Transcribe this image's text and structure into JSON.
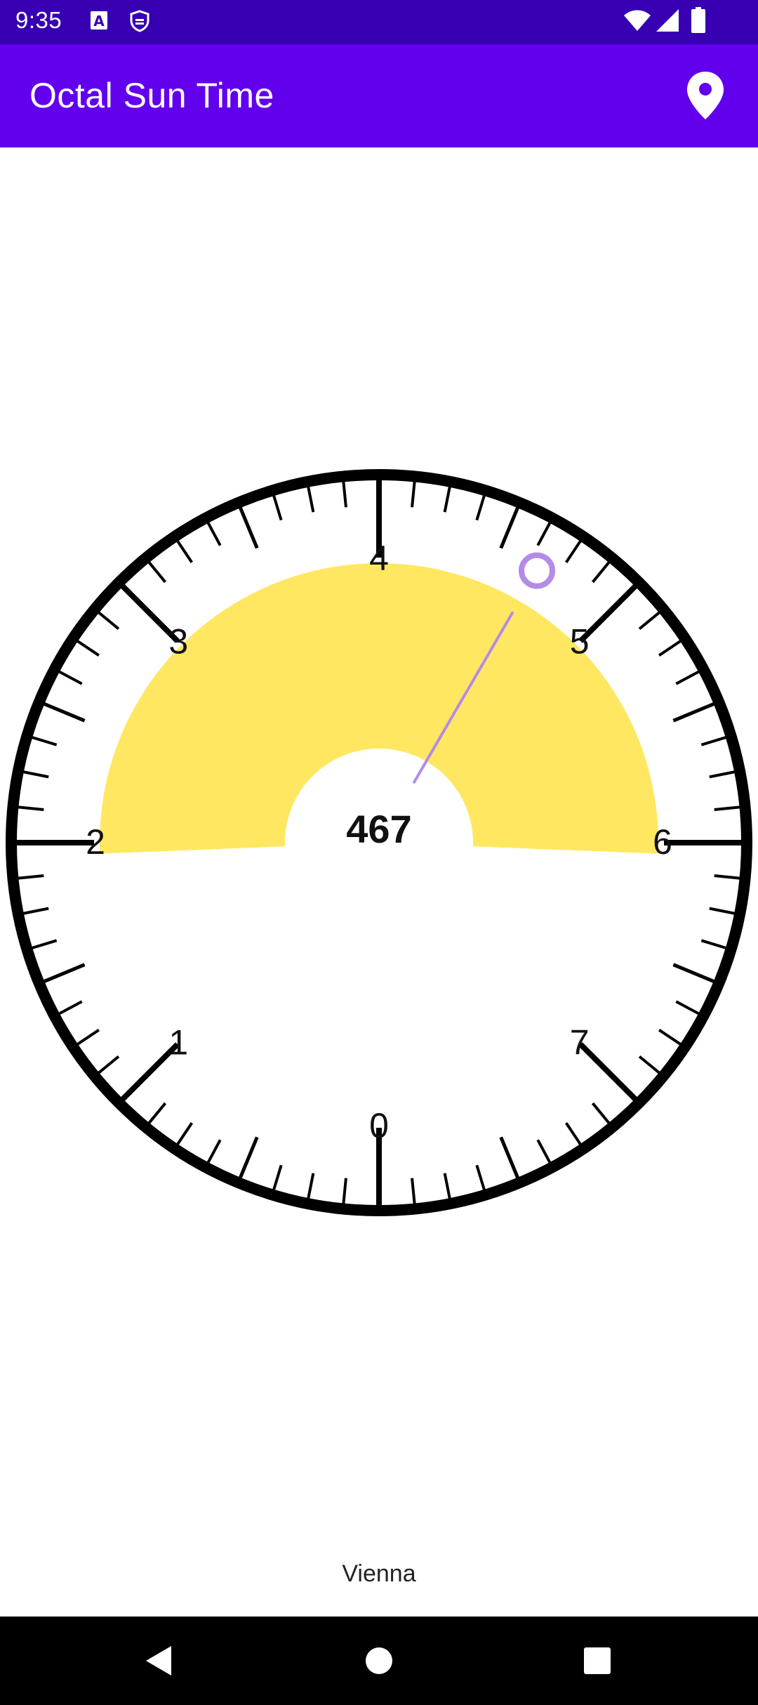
{
  "status_bar": {
    "time": "9:35",
    "icons": [
      "font-a-icon",
      "shield-key-icon",
      "wifi-icon",
      "signal-icon",
      "battery-icon"
    ]
  },
  "app_bar": {
    "title": "Octal Sun Time",
    "action_icon": "location-pin-icon"
  },
  "dial": {
    "center_value": "467",
    "hour_labels": [
      "0",
      "1",
      "2",
      "3",
      "4",
      "5",
      "6",
      "7"
    ],
    "hand_octal_hours": 4.67,
    "daylight_start_octal_hours": 1.95,
    "daylight_end_octal_hours": 6.05,
    "colors": {
      "ring": "#000000",
      "daylight": "#ffe761",
      "hand": "#b48be6"
    }
  },
  "location": {
    "city": "Vienna"
  },
  "nav_bar": {
    "icons": [
      "back-triangle-icon",
      "home-circle-icon",
      "recents-square-icon"
    ]
  },
  "colors": {
    "status_bar": "#3700b3",
    "app_bar": "#6200ee"
  }
}
